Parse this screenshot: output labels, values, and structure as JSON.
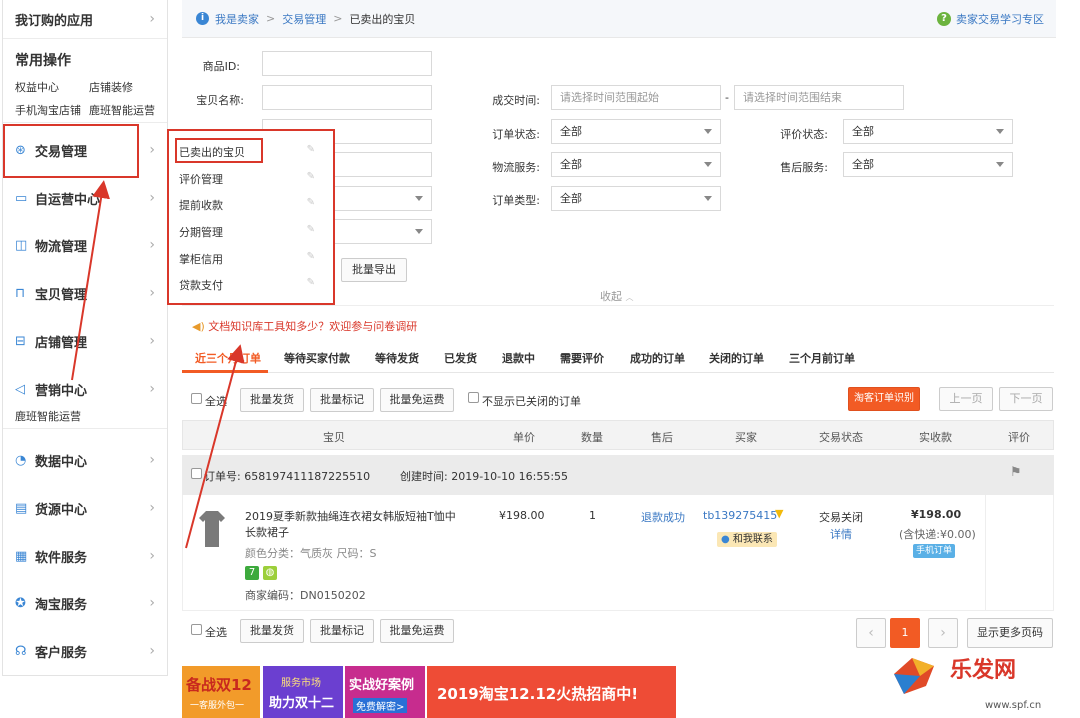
{
  "sidebar": {
    "top_title": "我订购的应用",
    "common_title": "常用操作",
    "quick_links": [
      "权益中心",
      "店铺装修",
      "手机淘宝店铺",
      "鹿班智能运营"
    ],
    "items": [
      {
        "label": "交易管理",
        "icon": "trade-icon"
      },
      {
        "label": "自运营中心",
        "icon": "chat-icon"
      },
      {
        "label": "物流管理",
        "icon": "truck-icon"
      },
      {
        "label": "宝贝管理",
        "icon": "bag-icon"
      },
      {
        "label": "店铺管理",
        "icon": "shop-icon"
      },
      {
        "label": "营销中心",
        "icon": "megaphone-icon"
      },
      {
        "label": "数据中心",
        "icon": "gauge-icon"
      },
      {
        "label": "货源中心",
        "icon": "box-icon"
      },
      {
        "label": "软件服务",
        "icon": "grid-icon"
      },
      {
        "label": "淘宝服务",
        "icon": "star-icon"
      },
      {
        "label": "客户服务",
        "icon": "headset-icon"
      }
    ],
    "marketing_sub": "鹿班智能运营"
  },
  "breadcrumb": {
    "items": [
      "我是卖家",
      "交易管理",
      "已卖出的宝贝"
    ],
    "help_link": "卖家交易学习专区"
  },
  "dropdown": {
    "items": [
      "已卖出的宝贝",
      "评价管理",
      "提前收款",
      "分期管理",
      "掌柜信用",
      "贷款支付"
    ]
  },
  "form": {
    "product_id_label": "商品ID:",
    "item_name_label": "宝贝名称:",
    "deal_time_label": "成交时间:",
    "time_start_placeholder": "请选择时间范围起始",
    "time_end_placeholder": "请选择时间范围结束",
    "time_dash": "-",
    "order_status_label": "订单状态:",
    "order_status_value": "全部",
    "review_status_label": "评价状态:",
    "review_status_value": "全部",
    "logistics_label": "物流服务:",
    "logistics_value": "全部",
    "aftersale_label": "售后服务:",
    "aftersale_value": "全部",
    "order_type_label": "订单类型:",
    "order_type_value": "全部",
    "batch_export": "批量导出",
    "collapse": "收起"
  },
  "notice": "文档知识库工具知多少？欢迎参与问卷调研",
  "tabs": [
    "近三个月订单",
    "等待买家付款",
    "等待发货",
    "已发货",
    "退款中",
    "需要评价",
    "成功的订单",
    "关闭的订单",
    "三个月前订单"
  ],
  "toolbar": {
    "select_all": "全选",
    "batch_ship": "批量发货",
    "batch_mark": "批量标记",
    "batch_free_ship": "批量免运费",
    "hide_closed": "不显示已关闭的订单",
    "taoke_button": "淘客订单识别",
    "prev_page": "上一页",
    "next_page": "下一页"
  },
  "table": {
    "headers": [
      "宝贝",
      "单价",
      "数量",
      "售后",
      "买家",
      "交易状态",
      "实收款",
      "评价"
    ]
  },
  "order": {
    "order_no_label": "订单号: 658197411187225510",
    "created_label": "创建时间: 2019-10-10 16:55:55",
    "title": "2019夏季新款抽绳连衣裙女韩版短袖T恤中长款裙子",
    "color_attr": "颜色分类：气质灰   尺码：S",
    "merchant_code": "商家编码：DN0150202",
    "price": "¥198.00",
    "quantity": "1",
    "aftersale": "退款成功",
    "buyer": "tb139275415",
    "contact": "和我联系",
    "status": "交易关闭",
    "detail": "详情",
    "received": "¥198.00",
    "shipping": "(含快递:¥0.00)",
    "mobile_order": "手机订单"
  },
  "pagination": {
    "prev": "‹",
    "current": "1",
    "next": "›",
    "more": "显示更多页码"
  },
  "banners": [
    {
      "line1": "备战双12",
      "line2": "一客服外包一",
      "color": "#e2502b"
    },
    {
      "line1": "服务市场",
      "line2": "助力双十二",
      "color": "#7a3fd6"
    },
    {
      "line1": "实战好案例",
      "line2": "免费解密>",
      "color": "#d0309a"
    },
    {
      "line1": "2019淘宝12.12火热招商中!",
      "line2": "",
      "color": "#e8502c"
    }
  ],
  "watermark": {
    "logo": "乐发网",
    "url": "www.spf.cn"
  }
}
